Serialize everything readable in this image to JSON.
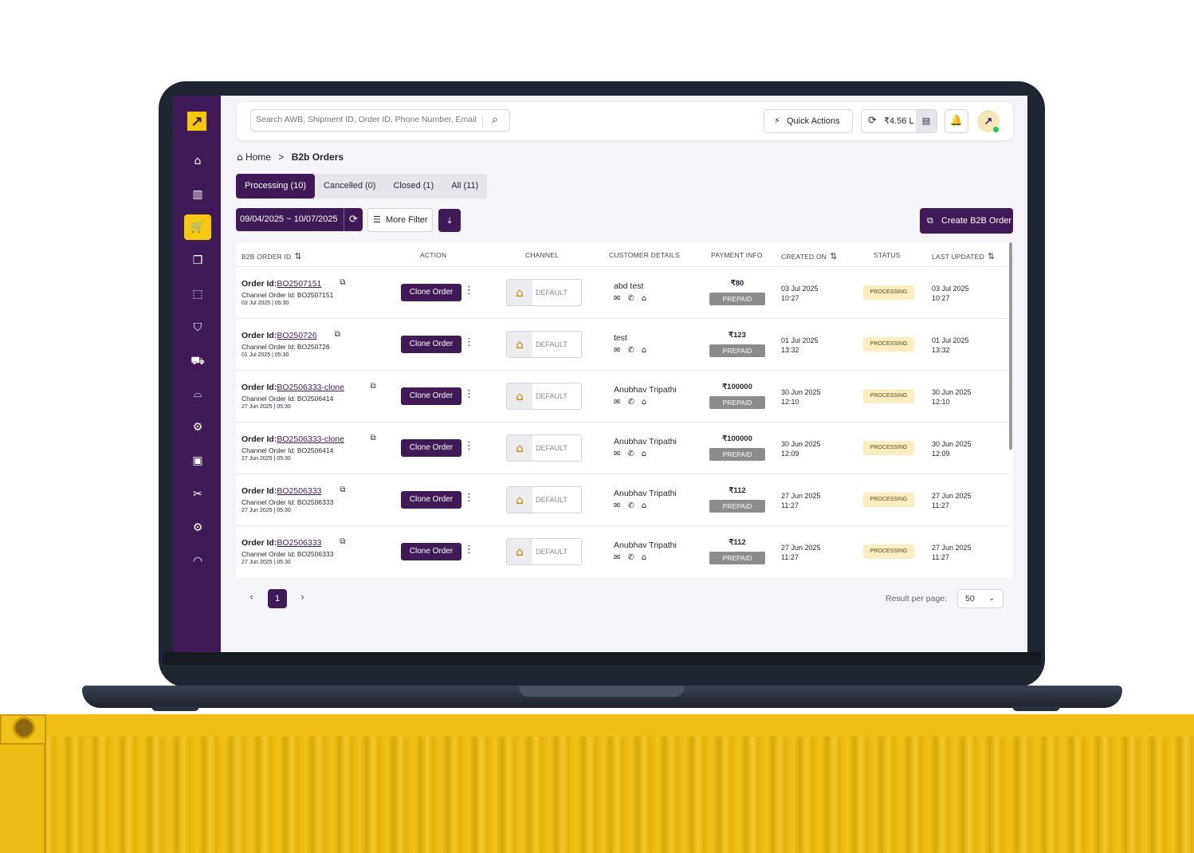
{
  "search": {
    "placeholder": "Search AWB, Shipment ID, Order ID, Phone Number, Email"
  },
  "header": {
    "quick_actions": "Quick Actions",
    "wallet_balance": "₹4.56 L"
  },
  "breadcrumb": {
    "home": "Home",
    "separator": ">",
    "current": "B2b Orders"
  },
  "tabs": [
    {
      "label": "Processing (10)",
      "active": true
    },
    {
      "label": "Cancelled (0)"
    },
    {
      "label": "Closed (1)"
    },
    {
      "label": "All (11)"
    }
  ],
  "filters": {
    "date_range": "09/04/2025 ~ 10/07/2025",
    "more_filter": "More Filter"
  },
  "create_button": "Create B2B Order",
  "table": {
    "columns": [
      "B2B ORDER ID",
      "ACTION",
      "CHANNEL",
      "CUSTOMER DETAILS",
      "PAYMENT INFO",
      "CREATED ON",
      "STATUS",
      "LAST UPDATED"
    ],
    "rows": [
      {
        "order_label": "Order Id:",
        "order_id": "BO2507151",
        "channel_order": "Channel Order Id: BO2507151",
        "order_date": "03 Jul 2025 | 05:30",
        "action": "Clone Order",
        "channel": "DEFAULT",
        "customer": "abd test",
        "amount": "₹80",
        "payment": "PREPAID",
        "created_date": "03 Jul 2025",
        "created_time": "10:27",
        "status": "PROCESSING",
        "updated_date": "03 Jul 2025",
        "updated_time": "10:27"
      },
      {
        "order_label": "Order Id:",
        "order_id": "BO250726",
        "channel_order": "Channel Order Id: BO250726",
        "order_date": "01 Jul 2025 | 05:30",
        "action": "Clone Order",
        "channel": "DEFAULT",
        "customer": "test",
        "amount": "₹123",
        "payment": "PREPAID",
        "created_date": "01 Jul 2025",
        "created_time": "13:32",
        "status": "PROCESSING",
        "updated_date": "01 Jul 2025",
        "updated_time": "13:32"
      },
      {
        "order_label": "Order Id:",
        "order_id": "BO2506333-clone",
        "channel_order": "Channel Order Id: BO2506414",
        "order_date": "27 Jun 2025 | 05:30",
        "action": "Clone Order",
        "channel": "DEFAULT",
        "customer": "Anubhav Tripathi",
        "amount": "₹100000",
        "payment": "PREPAID",
        "created_date": "30 Jun 2025",
        "created_time": "12:10",
        "status": "PROCESSING",
        "updated_date": "30 Jun 2025",
        "updated_time": "12:10"
      },
      {
        "order_label": "Order Id:",
        "order_id": "BO2506333-clone",
        "channel_order": "Channel Order Id: BO2506414",
        "order_date": "27 Jun 2025 | 05:30",
        "action": "Clone Order",
        "channel": "DEFAULT",
        "customer": "Anubhav Tripathi",
        "amount": "₹100000",
        "payment": "PREPAID",
        "created_date": "30 Jun 2025",
        "created_time": "12:09",
        "status": "PROCESSING",
        "updated_date": "30 Jun 2025",
        "updated_time": "12:09"
      },
      {
        "order_label": "Order Id:",
        "order_id": "BO2506333",
        "channel_order": "Channel Order Id: BO2506333",
        "order_date": "27 Jun 2025 | 05:30",
        "action": "Clone Order",
        "channel": "DEFAULT",
        "customer": "Anubhav Tripathi",
        "amount": "₹112",
        "payment": "PREPAID",
        "created_date": "27 Jun 2025",
        "created_time": "11:27",
        "status": "PROCESSING",
        "updated_date": "27 Jun 2025",
        "updated_time": "11:27"
      },
      {
        "order_label": "Order Id:",
        "order_id": "BO2506333",
        "channel_order": "Channel Order Id: BO2506333",
        "order_date": "27 Jun 2025 | 05:30",
        "action": "Clone Order",
        "channel": "DEFAULT",
        "customer": "Anubhav Tripathi",
        "amount": "₹112",
        "payment": "PREPAID",
        "created_date": "27 Jun 2025",
        "created_time": "11:27",
        "status": "PROCESSING",
        "updated_date": "27 Jun 2025",
        "updated_time": "11:27"
      }
    ]
  },
  "pagination": {
    "prev": "‹",
    "current_page": "1",
    "next": "›",
    "result_per_page_label": "Result per page:",
    "result_per_page_value": "50"
  },
  "sidebar": {
    "logo_glyph": "↗",
    "items": [
      {
        "icon": "home-icon",
        "glyph": "⌂"
      },
      {
        "icon": "analytics-icon",
        "glyph": "▥"
      },
      {
        "icon": "cart-icon",
        "glyph": "🛒",
        "active": true
      },
      {
        "icon": "box-icon",
        "glyph": "❒"
      },
      {
        "icon": "box-search-icon",
        "glyph": "⬚"
      },
      {
        "icon": "tshirt-icon",
        "glyph": "⛉"
      },
      {
        "icon": "truck-icon",
        "glyph": "⛟"
      },
      {
        "icon": "bag-icon",
        "glyph": "⌓"
      },
      {
        "icon": "settings-search-icon",
        "glyph": "⚙"
      },
      {
        "icon": "id-card-icon",
        "glyph": "▣"
      },
      {
        "icon": "tools-icon",
        "glyph": "✂"
      },
      {
        "icon": "gear-icon",
        "glyph": "⚙"
      },
      {
        "icon": "headset-icon",
        "glyph": "◠"
      }
    ]
  },
  "colors": {
    "brand": "#3f1a57",
    "accent": "#f6c90e",
    "status_bg": "#fbefc2",
    "prepaid_bg": "#8c8c8c"
  }
}
